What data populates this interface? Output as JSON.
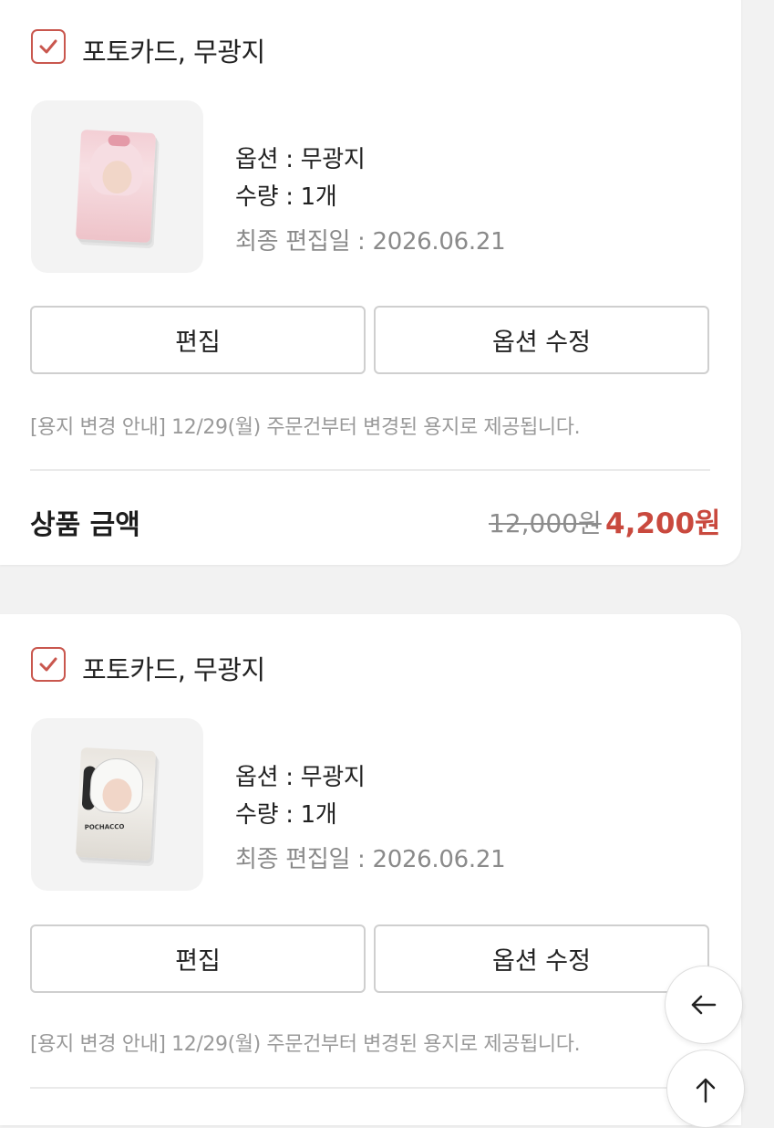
{
  "items": [
    {
      "title": "포토카드, 무광지",
      "option": "옵션 : 무광지",
      "quantity": "수량 : 1개",
      "edited": "최종 편집일 : 2026.06.21",
      "edit_label": "편집",
      "option_edit_label": "옵션 수정",
      "notice": "[용지 변경 안내] 12/29(월) 주문건부터 변경된 용지로 제공됩니다.",
      "price_label": "상품 금액",
      "original_price": "12,000원",
      "final_price": "4,200원",
      "checked": true,
      "thumbnail_icon": "photocard-pink-hood-image"
    },
    {
      "title": "포토카드, 무광지",
      "option": "옵션 : 무광지",
      "quantity": "수량 : 1개",
      "edited": "최종 편집일 : 2026.06.21",
      "edit_label": "편집",
      "option_edit_label": "옵션 수정",
      "notice": "[용지 변경 안내] 12/29(월) 주문건부터 변경된 용지로 제공됩니다.",
      "checked": true,
      "thumbnail_icon": "photocard-pochacco-hood-image",
      "thumbnail_text": "POCHACCO"
    }
  ],
  "floating": {
    "back_icon": "arrow-left-icon",
    "top_icon": "arrow-up-icon"
  },
  "colors": {
    "accent": "#c9574e",
    "price_accent": "#c9493e",
    "background": "#f2f2f2"
  }
}
